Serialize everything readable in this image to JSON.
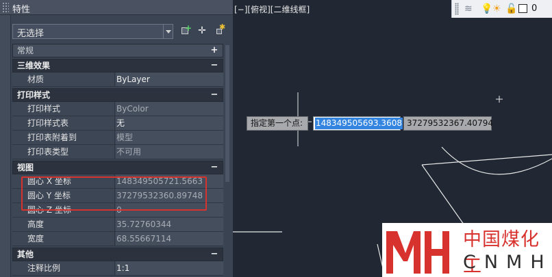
{
  "palette": {
    "title": "特性",
    "selection": "无选择",
    "toolbar": {
      "quick_select_icon": "quick-select-icon",
      "pick_icon": "select-objects-icon",
      "pickadd_icon": "toggle-pickadd-icon"
    },
    "sections": [
      {
        "title": "常规",
        "toggle": "+",
        "rows": []
      },
      {
        "title": "三维效果",
        "toggle": "−",
        "rows": [
          {
            "key": "材质",
            "value": "ByLayer",
            "dim": false
          }
        ]
      },
      {
        "title": "打印样式",
        "toggle": "−",
        "rows": [
          {
            "key": "打印样式",
            "value": "ByColor",
            "dim": true
          },
          {
            "key": "打印样式表",
            "value": "无",
            "dim": false
          },
          {
            "key": "打印表附着到",
            "value": "模型",
            "dim": true
          },
          {
            "key": "打印表类型",
            "value": "不可用",
            "dim": true
          }
        ]
      },
      {
        "title": "视图",
        "toggle": "−",
        "rows": [
          {
            "key": "圆心 X 坐标",
            "value": "148349505721.5663",
            "dim": true
          },
          {
            "key": "圆心 Y 坐标",
            "value": "37279532360.89748",
            "dim": true
          },
          {
            "key": "圆心 Z 坐标",
            "value": "0",
            "dim": true
          },
          {
            "key": "高度",
            "value": "35.72760344",
            "dim": true
          },
          {
            "key": "宽度",
            "value": "68.55667114",
            "dim": true
          }
        ]
      },
      {
        "title": "其他",
        "toggle": "−",
        "rows": [
          {
            "key": "注释比例",
            "value": "1:1",
            "dim": false
          }
        ]
      }
    ],
    "highlight_color": "#d8322e"
  },
  "viewport": {
    "label": "[−][俯视][二维线框]",
    "dynamic_input": {
      "prompt": "指定第一个点:",
      "x_value": "148349505693.3608",
      "y_value": "37279532367.40794"
    },
    "layer_toolbar": {
      "icons": [
        "layer-states-icon",
        "bulb-on-icon",
        "sun-freeze-icon",
        "lock-open-icon",
        "color-swatch-icon"
      ],
      "layer_name": "0"
    }
  },
  "watermark": {
    "chinese": "中国煤化工",
    "english": "CNMHG",
    "brand_color": "#d8322e"
  }
}
